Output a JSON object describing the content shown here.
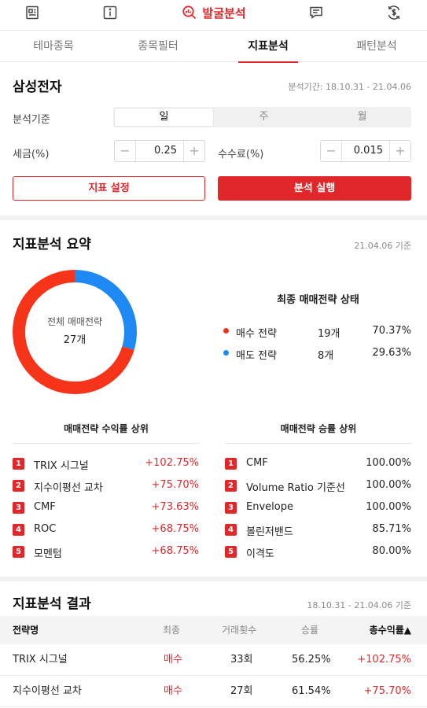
{
  "topnav": {
    "icons": [
      "newspaper-icon",
      "info-icon",
      "chat-icon",
      "exchange-icon"
    ],
    "active_label": "발굴분석"
  },
  "tabs": [
    {
      "label": "테마종목",
      "active": false
    },
    {
      "label": "종목필터",
      "active": false
    },
    {
      "label": "지표분석",
      "active": true
    },
    {
      "label": "패턴분석",
      "active": false
    }
  ],
  "stock": {
    "name": "삼성전자",
    "period": "분석기간: 18.10.31 - 21.04.06"
  },
  "settings": {
    "basis_label": "분석기준",
    "basis_options": [
      "일",
      "주",
      "월"
    ],
    "basis_selected": "일",
    "tax_label": "세금(%)",
    "tax_value": "0.25",
    "fee_label": "수수료(%)",
    "fee_value": "0.015",
    "minus": "−",
    "plus": "+",
    "settings_button": "지표 설정",
    "run_button": "분석 실행"
  },
  "summary": {
    "title": "지표분석 요약",
    "asof": "21.04.06 기준",
    "donut_label": "전체 매매전략",
    "donut_total": "27개",
    "status_title": "최종 매매전략 상태",
    "buy": {
      "label": "매수 전략",
      "count": "19개",
      "percent": "70.37%",
      "fraction": 0.7037,
      "color": "#f5341a"
    },
    "sell": {
      "label": "매도 전략",
      "count": "8개",
      "percent": "29.63%",
      "fraction": 0.2963,
      "color": "#1e88f3"
    }
  },
  "profit_rank": {
    "title": "매매전략 수익률 상위",
    "items": [
      {
        "rank": "1",
        "name": "TRIX 시그널",
        "value": "+102.75%"
      },
      {
        "rank": "2",
        "name": "지수이평선 교차",
        "value": "+75.70%"
      },
      {
        "rank": "3",
        "name": "CMF",
        "value": "+73.63%"
      },
      {
        "rank": "4",
        "name": "ROC",
        "value": "+68.75%"
      },
      {
        "rank": "5",
        "name": "모멘텀",
        "value": "+68.75%"
      }
    ]
  },
  "win_rank": {
    "title": "매매전략 승률 상위",
    "items": [
      {
        "rank": "1",
        "name": "CMF",
        "value": "100.00%"
      },
      {
        "rank": "2",
        "name": "Volume Ratio 기준선",
        "value": "100.00%"
      },
      {
        "rank": "3",
        "name": "Envelope",
        "value": "100.00%"
      },
      {
        "rank": "4",
        "name": "볼린저밴드",
        "value": "85.71%"
      },
      {
        "rank": "5",
        "name": "이격도",
        "value": "80.00%"
      }
    ]
  },
  "results": {
    "title": "지표분석 결과",
    "period": "18.10.31 - 21.04.06 기준",
    "columns": {
      "name": "전략명",
      "final": "최종",
      "trades": "거래횟수",
      "win": "승률",
      "total": "총수익률▲"
    },
    "rows": [
      {
        "name": "TRIX 시그널",
        "final": "매수",
        "trades": "33회",
        "win": "56.25%",
        "total": "+102.75%"
      },
      {
        "name": "지수이평선 교차",
        "final": "매수",
        "trades": "27회",
        "win": "61.54%",
        "total": "+75.70%"
      }
    ]
  }
}
